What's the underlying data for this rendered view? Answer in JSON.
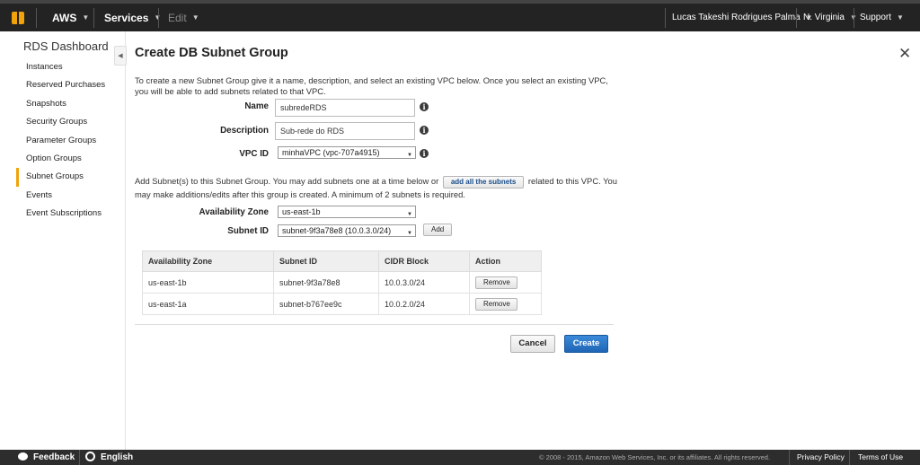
{
  "topbar": {
    "aws": "AWS",
    "services": "Services",
    "edit": "Edit",
    "user": "Lucas Takeshi Rodrigues Palma",
    "region": "N. Virginia",
    "support": "Support",
    "caret": "▼"
  },
  "sidebar": {
    "title": "RDS Dashboard",
    "items": [
      {
        "label": "Instances"
      },
      {
        "label": "Reserved Purchases"
      },
      {
        "label": "Snapshots"
      },
      {
        "label": "Security Groups"
      },
      {
        "label": "Parameter Groups"
      },
      {
        "label": "Option Groups"
      },
      {
        "label": "Subnet Groups"
      },
      {
        "label": "Events"
      },
      {
        "label": "Event Subscriptions"
      }
    ],
    "active_item": "Subnet Groups"
  },
  "dialog": {
    "title": "Create DB Subnet Group",
    "close": "✕",
    "intro": "To create a new Subnet Group give it a name, description, and select an existing VPC below. Once you select an existing VPC, you will be able to add subnets related to that VPC.",
    "name_label": "Name",
    "name_value": "subredeRDS",
    "description_label": "Description",
    "description_value": "Sub-rede do RDS",
    "vpc_label": "VPC ID",
    "vpc_value": "minhaVPC (vpc-707a4915)",
    "info_icon": "i",
    "add_text_before": "Add Subnet(s) to this Subnet Group. You may add subnets one at a time below or",
    "add_all_label": "add all the subnets",
    "add_text_after": "related to this VPC. You may make additions/edits after this group is created. A minimum of 2 subnets is required.",
    "az_label": "Availability Zone",
    "az_value": "us-east-1b",
    "subnet_label": "Subnet ID",
    "subnet_value": "subnet-9f3a78e8 (10.0.3.0/24)",
    "add_button": "Add",
    "cancel_button": "Cancel",
    "create_button": "Create"
  },
  "table": {
    "headers": [
      "Availability Zone",
      "Subnet ID",
      "CIDR Block",
      "Action"
    ],
    "rows": [
      {
        "az": "us-east-1b",
        "subnet": "subnet-9f3a78e8",
        "cidr": "10.0.3.0/24",
        "action": "Remove"
      },
      {
        "az": "us-east-1a",
        "subnet": "subnet-b767ee9c",
        "cidr": "10.0.2.0/24",
        "action": "Remove"
      }
    ]
  },
  "footer": {
    "feedback": "Feedback",
    "language": "English",
    "copyright": "© 2008 - 2015, Amazon Web Services, Inc. or its affiliates. All rights reserved.",
    "privacy": "Privacy Policy",
    "terms": "Terms of Use"
  },
  "colors": {
    "topbar_bg": "#232323",
    "accent_orange": "#f0a30a",
    "primary_button": "#1f66b5",
    "footer_bg": "#2d2d2d"
  }
}
